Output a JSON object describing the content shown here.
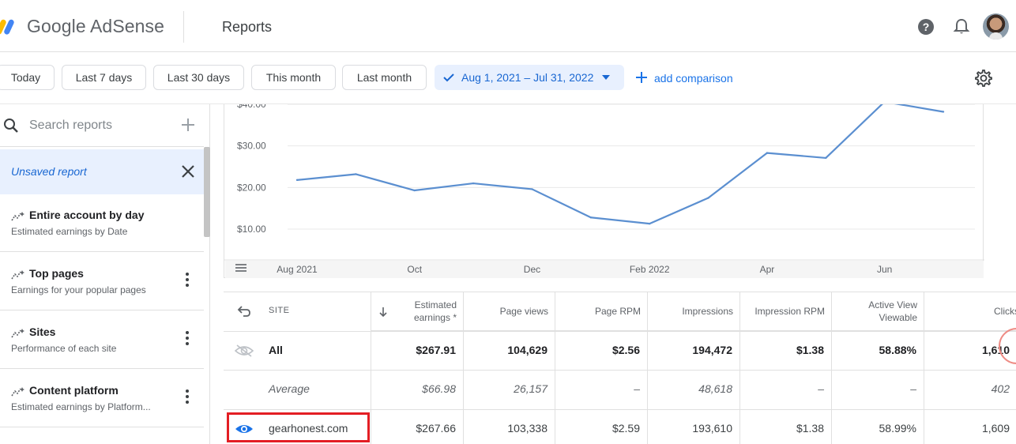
{
  "header": {
    "logo_text": "Google AdSense",
    "page_title": "Reports",
    "icons": [
      "help-icon",
      "bell-icon",
      "avatar"
    ]
  },
  "toolbar": {
    "chips": [
      "Today",
      "Last 7 days",
      "Last 30 days",
      "This month",
      "Last month"
    ],
    "date_range": "Aug 1, 2021 – Jul 31, 2022",
    "add_comparison": "add comparison"
  },
  "sidebar": {
    "search_placeholder": "Search reports",
    "unsaved": "Unsaved report",
    "items": [
      {
        "title": "Entire account by day",
        "subtitle": "Estimated earnings by Date"
      },
      {
        "title": "Top pages",
        "subtitle": "Earnings for your popular pages"
      },
      {
        "title": "Sites",
        "subtitle": "Performance of each site"
      },
      {
        "title": "Content platform",
        "subtitle": "Estimated earnings by Platform..."
      }
    ]
  },
  "chart_data": {
    "type": "line",
    "x": [
      "Aug 2021",
      "Sep 2021",
      "Oct 2021",
      "Nov 2021",
      "Dec 2021",
      "Jan 2022",
      "Feb 2022",
      "Mar 2022",
      "Apr 2022",
      "May 2022",
      "Jun 2022",
      "Jul 2022"
    ],
    "x_tick_labels": [
      "Aug 2021",
      "Oct",
      "Dec",
      "Feb 2022",
      "Apr",
      "Jun"
    ],
    "y_tick_labels": [
      "$40.00",
      "$30.00",
      "$20.00",
      "$10.00"
    ],
    "ylim": [
      0,
      42
    ],
    "series": [
      {
        "values": [
          21.8,
          23.2,
          19.3,
          21.0,
          19.6,
          12.8,
          11.3,
          17.5,
          28.3,
          27.1,
          40.6,
          38.2
        ],
        "color": "#5b8fd0"
      }
    ]
  },
  "table": {
    "headers": [
      "SITE",
      "Estimated earnings *",
      "Page views",
      "Page RPM",
      "Impressions",
      "Impression RPM",
      "Active View Viewable",
      "Clicks"
    ],
    "rows": [
      {
        "site": "All",
        "values": [
          "$267.91",
          "104,629",
          "$2.56",
          "194,472",
          "$1.38",
          "58.88%",
          "1,610"
        ]
      },
      {
        "site": "Average",
        "values": [
          "$66.98",
          "26,157",
          "–",
          "48,618",
          "–",
          "–",
          "402"
        ]
      },
      {
        "site": "gearhonest.com",
        "values": [
          "$267.66",
          "103,338",
          "$2.59",
          "193,610",
          "$1.38",
          "58.99%",
          "1,609"
        ]
      }
    ]
  },
  "colors": {
    "accent_blue": "#1a73e8",
    "date_chip_bg": "#e8f0fe",
    "highlight_red": "#e31e24",
    "line": "#5b8fd0"
  }
}
